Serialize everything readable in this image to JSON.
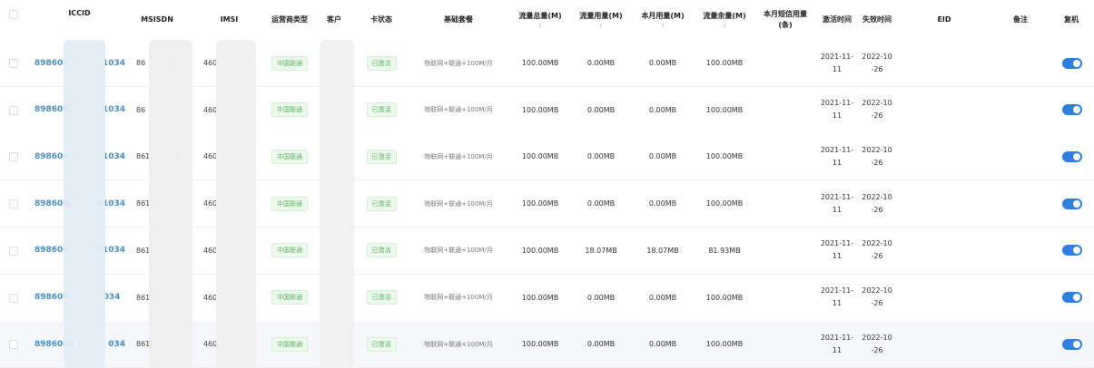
{
  "columns": {
    "iccid": "ICCID",
    "msisdn": "MSISDN",
    "imsi": "IMSI",
    "operator_type": "运营商类型",
    "customer": "客户",
    "card_status": "卡状态",
    "base_package": "基础套餐",
    "total_traffic": "流量总量(M)",
    "used_traffic": "流量用量(M)",
    "month_usage": "本月用量(M)",
    "remaining_traffic": "流量余量(M)",
    "sms_month_line1": "本月短信用量",
    "sms_month_line2": "(条)",
    "activation_time": "激活时间",
    "expiry_time": "失效时间",
    "eid": "EID",
    "remark": "备注",
    "restart": "复机"
  },
  "sort_icon": "⇕",
  "colors": {
    "link": "#4a8ec6",
    "tag_green": "#57b45e",
    "toggle_on": "#2f7fe0"
  },
  "rows": [
    {
      "iccid": "898606",
      "iccid_tail": "1034",
      "msisdn_a": "86",
      "msisdn_b": "03",
      "imsi_a": "460",
      "imsi_b": "3",
      "operator": "中国联通",
      "status": "已激活",
      "package": "物联网+联通+100M/月",
      "total": "100.00MB",
      "used": "0.00MB",
      "month": "0.00MB",
      "remaining": "100.00MB",
      "act_1": "2021-11-",
      "act_2": "11",
      "exp_1": "2022-10",
      "exp_2": "-26",
      "restart_on": true
    },
    {
      "iccid": "898606",
      "iccid_tail": "1034",
      "msisdn_a": "86",
      "msisdn_b": "3",
      "imsi_a": "460",
      "imsi_b": "3",
      "operator": "中国联通",
      "status": "已激活",
      "package": "物联网+联通+100M/月",
      "total": "100.00MB",
      "used": "0.00MB",
      "month": "0.00MB",
      "remaining": "100.00MB",
      "act_1": "2021-11-",
      "act_2": "11",
      "exp_1": "2022-10",
      "exp_2": "-26",
      "restart_on": true
    },
    {
      "iccid": "898606",
      "iccid_tail": "1034",
      "msisdn_a": "861",
      "msisdn_b": "3",
      "imsi_a": "460",
      "imsi_b": "",
      "operator": "中国联通",
      "status": "已激活",
      "package": "物联网+联通+100M/月",
      "total": "100.00MB",
      "used": "0.00MB",
      "month": "0.00MB",
      "remaining": "100.00MB",
      "act_1": "2021-11-",
      "act_2": "11",
      "exp_1": "2022-10",
      "exp_2": "-26",
      "restart_on": true
    },
    {
      "iccid": "898606",
      "iccid_tail": "01034",
      "msisdn_a": "861",
      "msisdn_b": "",
      "imsi_a": "4600",
      "imsi_b": "",
      "operator": "中国联通",
      "status": "已激活",
      "package": "物联网+联通+100M/月",
      "total": "100.00MB",
      "used": "0.00MB",
      "month": "0.00MB",
      "remaining": "100.00MB",
      "act_1": "2021-11-",
      "act_2": "11",
      "exp_1": "2022-10",
      "exp_2": "-26",
      "restart_on": true
    },
    {
      "iccid": "898606",
      "iccid_tail": "01034",
      "msisdn_a": "8610",
      "msisdn_b": "",
      "imsi_a": "460",
      "imsi_b": "",
      "operator": "中国联通",
      "status": "已激活",
      "package": "物联网+联通+100M/月",
      "total": "100.00MB",
      "used": "18.07MB",
      "month": "18.07MB",
      "remaining": "81.93MB",
      "act_1": "2021-11-",
      "act_2": "11",
      "exp_1": "2022-10",
      "exp_2": "-26",
      "restart_on": true
    },
    {
      "iccid": "898606",
      "iccid_tail": "034",
      "msisdn_a": "8610",
      "msisdn_b": "",
      "imsi_a": "460",
      "imsi_b": "",
      "operator": "中国联通",
      "status": "已激活",
      "package": "物联网+联通+100M/月",
      "total": "100.00MB",
      "used": "0.00MB",
      "month": "0.00MB",
      "remaining": "100.00MB",
      "act_1": "2021-11-",
      "act_2": "11",
      "exp_1": "2022-10",
      "exp_2": "-26",
      "restart_on": true
    },
    {
      "iccid": "8986062",
      "iccid_tail": "034",
      "msisdn_a": "8610",
      "msisdn_b": "",
      "imsi_a": "460",
      "imsi_b": "3",
      "operator": "中国联通",
      "status": "已激活",
      "package": "物联网+联通+100M/月",
      "total": "100.00MB",
      "used": "0.00MB",
      "month": "0.00MB",
      "remaining": "100.00MB",
      "act_1": "2021-11-",
      "act_2": "11",
      "exp_1": "2022-10",
      "exp_2": "-26",
      "restart_on": true
    }
  ]
}
